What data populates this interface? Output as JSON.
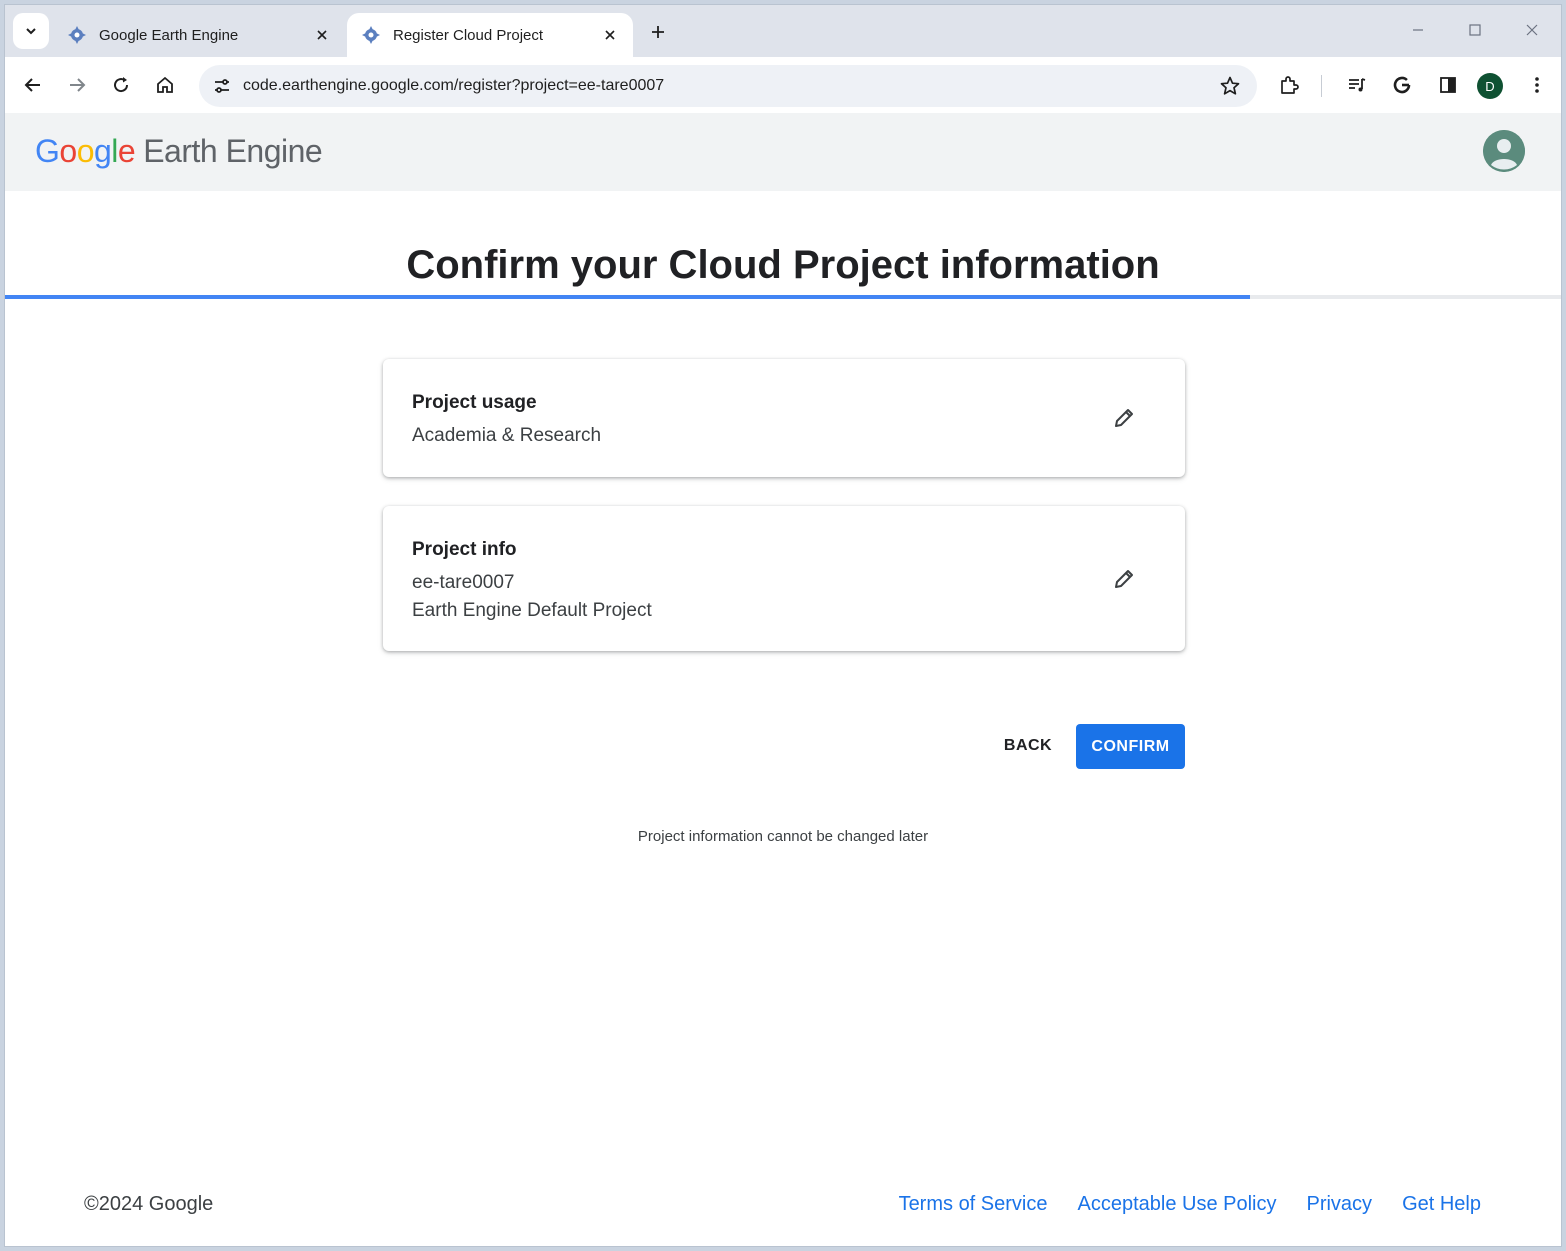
{
  "browser": {
    "tabs": [
      {
        "title": "Google Earth Engine",
        "active": false
      },
      {
        "title": "Register Cloud Project",
        "active": true
      }
    ],
    "url": "code.earthengine.google.com/register?project=ee-tare0007",
    "profile_initial": "D"
  },
  "app": {
    "brand_google_letters": [
      "G",
      "o",
      "o",
      "g",
      "l",
      "e"
    ],
    "brand_suffix": "Earth Engine",
    "progress_fraction": 0.8
  },
  "page": {
    "heading": "Confirm your Cloud Project information",
    "usage_card": {
      "label": "Project usage",
      "value": "Academia & Research"
    },
    "info_card": {
      "label": "Project info",
      "project_id": "ee-tare0007",
      "project_name": "Earth Engine Default Project"
    },
    "back_label": "BACK",
    "confirm_label": "CONFIRM",
    "note": "Project information cannot be changed later"
  },
  "footer": {
    "copyright": "©2024 Google",
    "links": [
      "Terms of Service",
      "Acceptable Use Policy",
      "Privacy",
      "Get Help"
    ]
  },
  "colors": {
    "accent": "#1a73e8",
    "progress": "#4285f4",
    "header_bg": "#f1f3f4"
  }
}
